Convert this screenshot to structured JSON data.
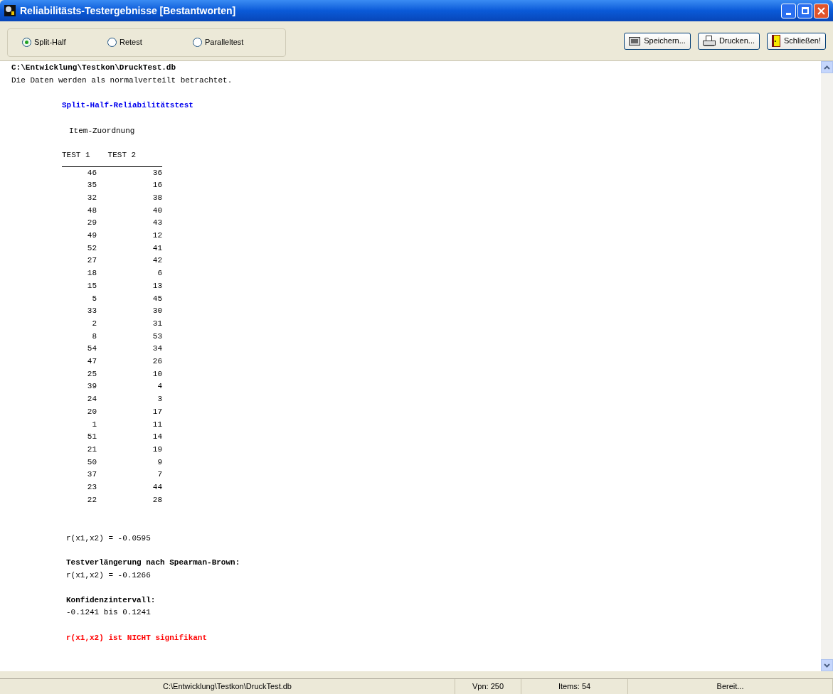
{
  "window": {
    "title": "Reliabilitästs-Testergebnisse [Bestantworten]"
  },
  "radio_options": [
    {
      "label": "Split-Half",
      "selected": true
    },
    {
      "label": "Retest",
      "selected": false
    },
    {
      "label": "Paralleltest",
      "selected": false
    }
  ],
  "buttons": [
    {
      "label": "Speichern...",
      "kind": "save"
    },
    {
      "label": "Drucken...",
      "kind": "print"
    },
    {
      "label": "Schließen!",
      "kind": "close"
    }
  ],
  "report": {
    "file_path": "C:\\Entwicklung\\Testkon\\DruckTest.db",
    "note": "Die Daten werden als normalverteilt betrachtet.",
    "section_title": "Split-Half-Reliabilitätstest",
    "assignment_title": "Item-Zuordnung",
    "columns": [
      "TEST 1",
      "TEST 2"
    ],
    "rows": [
      [
        "46",
        "36"
      ],
      [
        "35",
        "16"
      ],
      [
        "32",
        "38"
      ],
      [
        "48",
        "40"
      ],
      [
        "29",
        "43"
      ],
      [
        "49",
        "12"
      ],
      [
        "52",
        "41"
      ],
      [
        "27",
        "42"
      ],
      [
        "18",
        "6"
      ],
      [
        "15",
        "13"
      ],
      [
        "5",
        "45"
      ],
      [
        "33",
        "30"
      ],
      [
        "2",
        "31"
      ],
      [
        "8",
        "53"
      ],
      [
        "54",
        "34"
      ],
      [
        "47",
        "26"
      ],
      [
        "25",
        "10"
      ],
      [
        "39",
        "4"
      ],
      [
        "24",
        "3"
      ],
      [
        "20",
        "17"
      ],
      [
        "1",
        "11"
      ],
      [
        "51",
        "14"
      ],
      [
        "21",
        "19"
      ],
      [
        "50",
        "9"
      ],
      [
        "37",
        "7"
      ],
      [
        "23",
        "44"
      ],
      [
        "22",
        "28"
      ]
    ],
    "correlation": "r(x1,x2) = -0.0595",
    "spearman_brown_title": "Testverlängerung nach Spearman-Brown:",
    "spearman_brown_value": "r(x1,x2) = -0.1266",
    "ci_title": "Konfidenzintervall:",
    "ci_value": "-0.1241 bis 0.1241",
    "verdict": "r(x1,x2) ist NICHT signifikant"
  },
  "status_bar": [
    "C:\\Entwicklung\\Testkon\\DruckTest.db",
    "Vpn: 250",
    "Items: 54",
    "Bereit..."
  ]
}
